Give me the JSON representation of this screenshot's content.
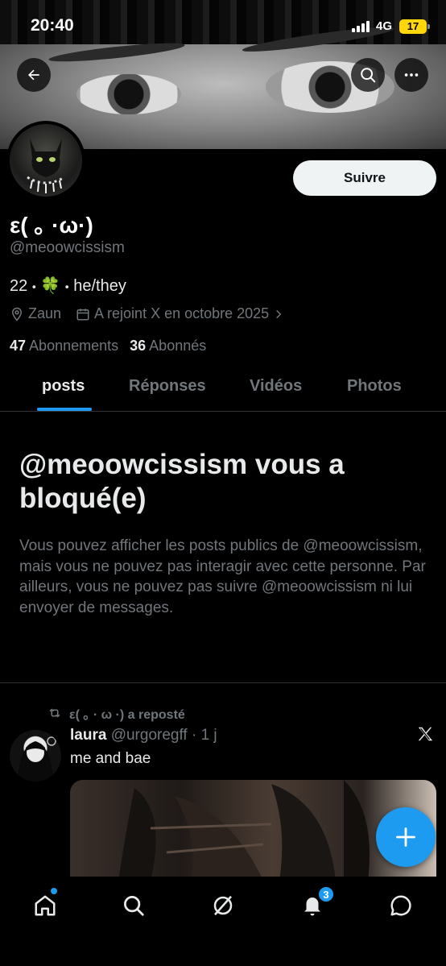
{
  "status_bar": {
    "time": "20:40",
    "network": "4G",
    "battery": "17"
  },
  "profile": {
    "display_name": "ε( ｡ ·ω·)",
    "handle": "@meoowcissism",
    "bio_age": "22",
    "bio_emoji": "🍀",
    "bio_pronouns": "he/they",
    "bio_sep": "•",
    "location": "Zaun",
    "joined": "A rejoint X en octobre 2025",
    "following_count": "47",
    "following_label": "Abonnements",
    "followers_count": "36",
    "followers_label": "Abonnés",
    "follow_button": "Suivre"
  },
  "tabs": [
    {
      "label": "posts",
      "active": true
    },
    {
      "label": "Réponses",
      "active": false
    },
    {
      "label": "Vidéos",
      "active": false
    },
    {
      "label": "Photos",
      "active": false
    }
  ],
  "blocked": {
    "title": "@meoowcissism vous a bloqué(e)",
    "message": "Vous pouvez afficher les posts publics de @meoowcissism, mais vous ne pouvez pas interagir avec cette personne. Par ailleurs, vous ne pouvez pas suivre @meoowcissism ni lui envoyer de messages."
  },
  "post": {
    "repost_label": "ε( ｡ · ω ·) a reposté",
    "author_name": "laura",
    "author_handle": "@urgoregff",
    "age": "· 1 j",
    "text": "me and bae"
  },
  "nav": {
    "notifications_badge": "3"
  },
  "colors": {
    "accent": "#1d9bf0",
    "background": "#000000",
    "muted": "#71767b",
    "battery": "#ffd60a"
  },
  "icons": [
    "back-arrow-icon",
    "search-icon",
    "more-icon",
    "location-icon",
    "calendar-icon",
    "chevron-right-icon",
    "repost-icon",
    "x-logo-icon",
    "plus-icon",
    "home-icon",
    "explore-icon",
    "grok-icon",
    "bell-icon",
    "messages-icon"
  ]
}
